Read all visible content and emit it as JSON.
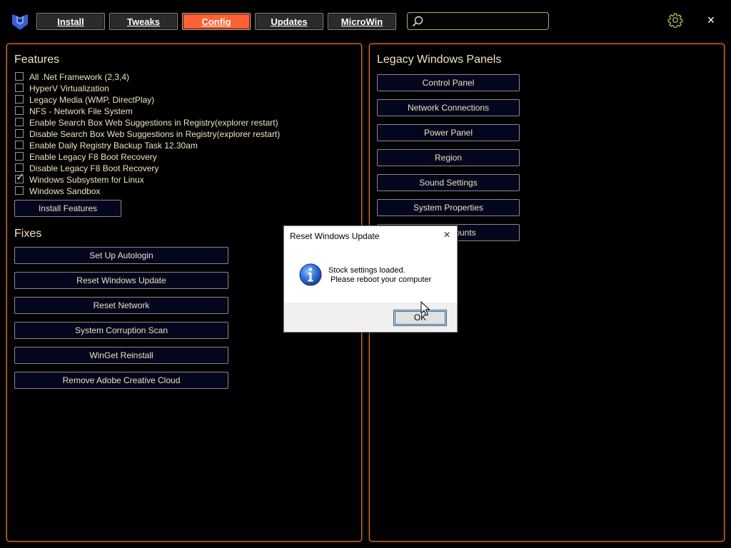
{
  "app": {
    "logo_icon": "winutil-logo-icon",
    "accent_color": "#ff6034",
    "border_color": "#e07a2e"
  },
  "tabs": [
    {
      "label": "Install",
      "active": false
    },
    {
      "label": "Tweaks",
      "active": false
    },
    {
      "label": "Config",
      "active": true
    },
    {
      "label": "Updates",
      "active": false
    },
    {
      "label": "MicroWin",
      "active": false
    }
  ],
  "search": {
    "value": "",
    "placeholder": "",
    "icon": "search-icon"
  },
  "header_icons": {
    "settings": "gear-icon",
    "close": "×"
  },
  "features": {
    "title": "Features",
    "items": [
      {
        "label": "All .Net Framework (2,3,4)",
        "checked": false
      },
      {
        "label": "HyperV Virtualization",
        "checked": false
      },
      {
        "label": "Legacy Media (WMP, DirectPlay)",
        "checked": false
      },
      {
        "label": "NFS - Network File System",
        "checked": false
      },
      {
        "label": "Enable Search Box Web Suggestions in Registry(explorer restart)",
        "checked": false
      },
      {
        "label": "Disable Search Box Web Suggestions in Registry(explorer restart)",
        "checked": false
      },
      {
        "label": "Enable Daily Registry Backup Task 12.30am",
        "checked": false
      },
      {
        "label": "Enable Legacy F8 Boot Recovery",
        "checked": false
      },
      {
        "label": "Disable Legacy F8 Boot Recovery",
        "checked": false
      },
      {
        "label": "Windows Subsystem for Linux",
        "checked": true
      },
      {
        "label": "Windows Sandbox",
        "checked": false
      }
    ],
    "install_button": "Install Features"
  },
  "fixes": {
    "title": "Fixes",
    "buttons": [
      "Set Up Autologin",
      "Reset Windows Update",
      "Reset Network",
      "System Corruption Scan",
      "WinGet Reinstall",
      "Remove Adobe Creative Cloud"
    ]
  },
  "legacy_panels": {
    "title": "Legacy Windows Panels",
    "buttons": [
      "Control Panel",
      "Network Connections",
      "Power Panel",
      "Region",
      "Sound Settings",
      "System Properties",
      "User Accounts"
    ]
  },
  "dialog": {
    "title": "Reset Windows Update",
    "message_line1": "Stock settings loaded.",
    "message_line2": "Please reboot your computer",
    "ok_label": "OK",
    "icon": "info-icon",
    "close": "×"
  }
}
